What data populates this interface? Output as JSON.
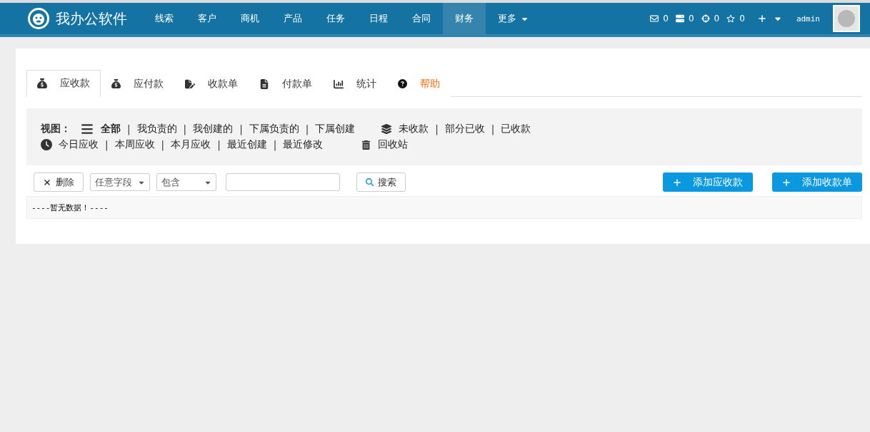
{
  "brand": {
    "name": "我办公软件"
  },
  "nav": [
    {
      "label": "线索",
      "selected": false,
      "dropdown": false
    },
    {
      "label": "客户",
      "selected": false,
      "dropdown": false
    },
    {
      "label": "商机",
      "selected": false,
      "dropdown": false
    },
    {
      "label": "产品",
      "selected": false,
      "dropdown": false
    },
    {
      "label": "任务",
      "selected": false,
      "dropdown": false
    },
    {
      "label": "日程",
      "selected": false,
      "dropdown": false
    },
    {
      "label": "合同",
      "selected": false,
      "dropdown": false
    },
    {
      "label": "财务",
      "selected": true,
      "dropdown": false
    },
    {
      "label": "更多",
      "selected": false,
      "dropdown": true
    }
  ],
  "counters": [
    {
      "kind": "mail",
      "count": "0"
    },
    {
      "kind": "list",
      "count": "0"
    },
    {
      "kind": "target",
      "count": "0"
    },
    {
      "kind": "star",
      "count": "0"
    }
  ],
  "user": {
    "name": "admin"
  },
  "tabs": [
    {
      "kind": "receivable",
      "label": "应收款",
      "selected": true
    },
    {
      "kind": "payable",
      "label": "应付款",
      "selected": false
    },
    {
      "kind": "receipt",
      "label": "收款单",
      "selected": false
    },
    {
      "kind": "payment",
      "label": "付款单",
      "selected": false
    },
    {
      "kind": "stats",
      "label": "统计",
      "selected": false
    },
    {
      "kind": "help",
      "label": "帮助",
      "selected": false
    }
  ],
  "views": {
    "label": "视图：",
    "separator": "|",
    "groups": [
      {
        "kind": "list",
        "items": [
          {
            "label": "全部",
            "selected": true
          },
          {
            "label": "我负责的",
            "selected": false
          },
          {
            "label": "我创建的",
            "selected": false
          },
          {
            "label": "下属负责的",
            "selected": false
          },
          {
            "label": "下属创建",
            "selected": false
          }
        ]
      },
      {
        "kind": "layers",
        "items": [
          {
            "label": "未收款",
            "selected": false
          },
          {
            "label": "部分已收",
            "selected": false
          },
          {
            "label": "已收款",
            "selected": false
          }
        ]
      },
      {
        "kind": "clock",
        "items": [
          {
            "label": "今日应收",
            "selected": false
          },
          {
            "label": "本周应收",
            "selected": false
          },
          {
            "label": "本月应收",
            "selected": false
          },
          {
            "label": "最近创建",
            "selected": false
          },
          {
            "label": "最近修改",
            "selected": false
          }
        ]
      },
      {
        "kind": "trash",
        "items": [
          {
            "label": "回收站",
            "selected": false
          }
        ]
      }
    ]
  },
  "toolbar": {
    "delete": "删除",
    "field_select": "任意字段",
    "condition_select": "包含",
    "search": "搜索",
    "add_buttons": [
      "添加应收款",
      "添加收款单"
    ]
  },
  "table": {
    "empty_message": "----暂无数据！----"
  }
}
